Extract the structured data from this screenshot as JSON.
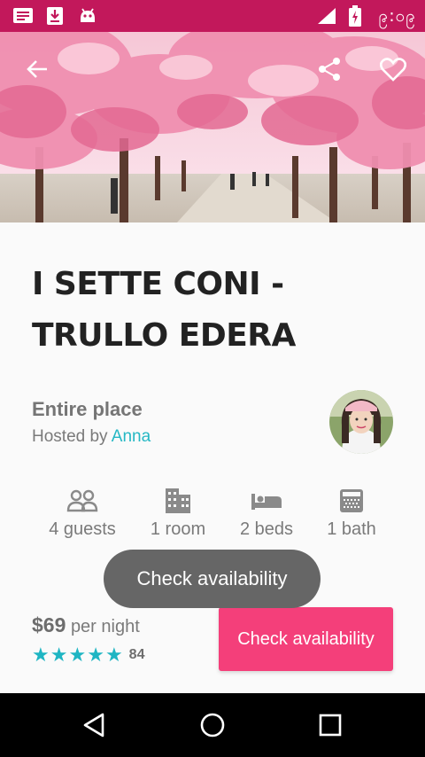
{
  "status_bar": {
    "time": "၉:၀၉"
  },
  "hero": {
    "image_alt": "cherry-blossom-avenue"
  },
  "listing": {
    "title": "I SETTE CONI - TRULLO EDERA",
    "place_type": "Entire place",
    "hosted_by_prefix": "Hosted by",
    "host_name": "Anna"
  },
  "amenities": [
    {
      "icon": "guests-icon",
      "label": "4 guests"
    },
    {
      "icon": "room-icon",
      "label": "1 room"
    },
    {
      "icon": "bed-icon",
      "label": "2 beds"
    },
    {
      "icon": "bath-icon",
      "label": "1 bath"
    }
  ],
  "toast": {
    "text": "Check availability"
  },
  "booking": {
    "price": "$69",
    "price_unit": "per night",
    "rating_stars": 5,
    "review_count": "84",
    "cta_label": "Check availability"
  },
  "colors": {
    "status_bar": "#c2185b",
    "accent_teal": "#26b8c4",
    "cta_pink": "#f43f7a",
    "toast_bg": "#666666"
  }
}
